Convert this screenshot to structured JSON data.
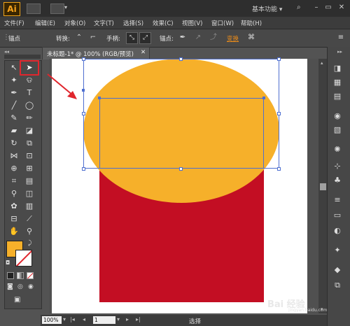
{
  "app": {
    "logo": "Ai",
    "workspace": "基本功能",
    "workspace_arrow": "▾",
    "search_icon": "search-icon",
    "win_min": "–",
    "win_max": "▭",
    "win_close": "✕"
  },
  "menu": [
    "文件(F)",
    "编辑(E)",
    "对象(O)",
    "文字(T)",
    "选择(S)",
    "效果(C)",
    "视图(V)",
    "窗口(W)",
    "帮助(H)"
  ],
  "control": {
    "anchor_label": "锚点",
    "convert_label": "转换:",
    "handle_label": "手柄:",
    "anchor2_label": "锚点:",
    "transform_label": "变换",
    "transform_color": "#e88a1a"
  },
  "tab": {
    "title": "未标题-1* @ 100% (RGB/预览)",
    "close": "✕"
  },
  "status": {
    "zoom": "100%",
    "page": "1",
    "mode": "选择",
    "prev_first": "|◂",
    "prev": "◂",
    "next": "▸",
    "next_last": "▸|"
  },
  "colors": {
    "fill": "#f6b02a",
    "shape_red": "#c30e23",
    "selection": "#4e6fd0",
    "highlight": "#e0262d"
  },
  "watermark": {
    "text": "Bai 经验",
    "sub": "jingyan.baidu.com"
  }
}
